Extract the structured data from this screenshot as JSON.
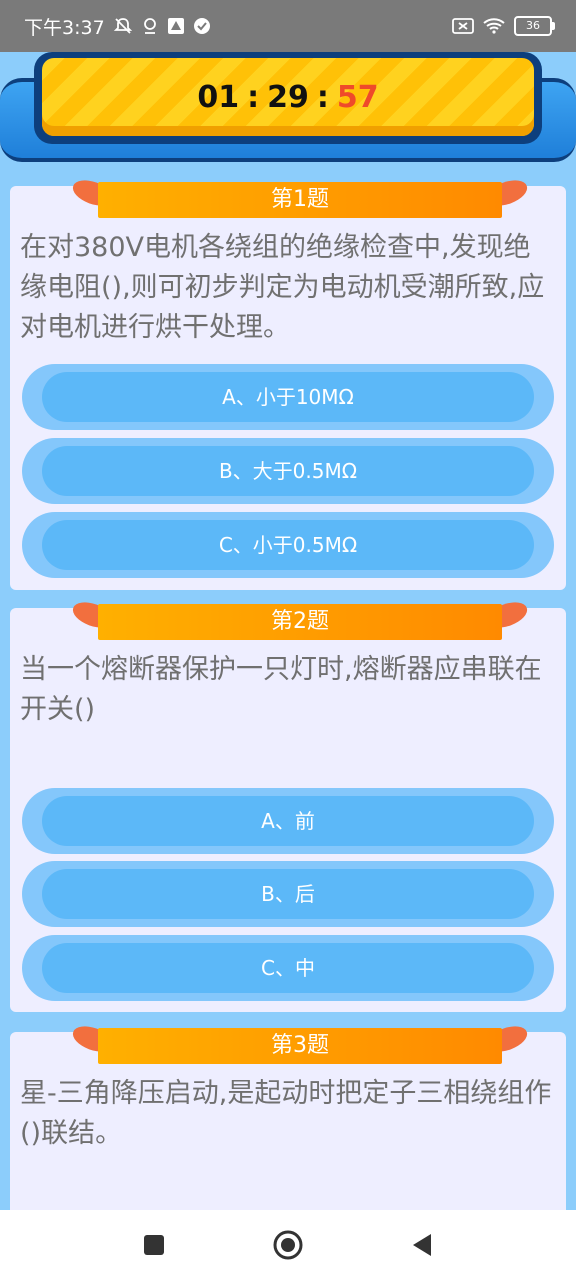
{
  "status_bar": {
    "time": "下午3:37",
    "battery": "36",
    "icons": [
      "mute-icon",
      "location-icon",
      "app-icon",
      "check-icon",
      "sim-off-icon",
      "wifi-icon",
      "battery-icon"
    ]
  },
  "timer": {
    "hours": "01",
    "minutes": "29",
    "seconds": "57",
    "sep": ":"
  },
  "questions": [
    {
      "title": "第1题",
      "text": "在对380V电机各绕组的绝缘检查中,发现绝缘电阻(),则可初步判定为电动机受潮所致,应对电机进行烘干处理。",
      "options": [
        "A、小于10MΩ",
        "B、大于0.5MΩ",
        "C、小于0.5MΩ"
      ]
    },
    {
      "title": "第2题",
      "text": "当一个熔断器保护一只灯时,熔断器应串联在开关()",
      "options": [
        "A、前",
        "B、后",
        "C、中"
      ]
    },
    {
      "title": "第3题",
      "text": "星-三角降压启动,是起动时把定子三相绕组作()联结。",
      "options": []
    }
  ],
  "colors": {
    "background": "#8ccdfb",
    "card": "#eeeeff",
    "option": "#5cb8f8",
    "ribbon": "#ff9a00",
    "seconds": "#ef4a2a"
  },
  "nav": {
    "icons": [
      "recents-icon",
      "home-icon",
      "back-icon"
    ]
  }
}
